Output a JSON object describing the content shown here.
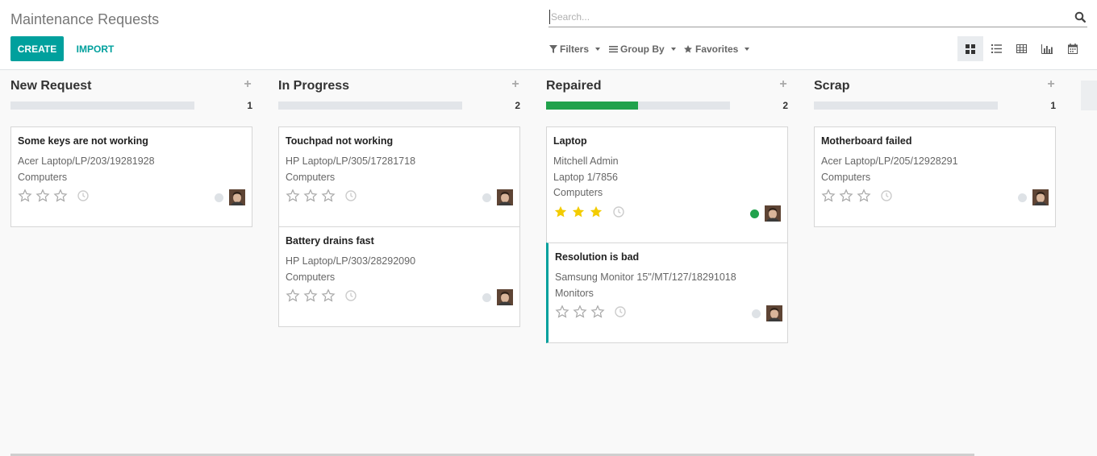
{
  "header": {
    "title": "Maintenance Requests",
    "create_label": "CREATE",
    "import_label": "IMPORT"
  },
  "search": {
    "placeholder": "Search...",
    "icon": "search-icon"
  },
  "filters": {
    "filters_label": "Filters",
    "groupby_label": "Group By",
    "favorites_label": "Favorites"
  },
  "views": [
    "kanban-view",
    "list-view",
    "pivot-view",
    "graph-view",
    "calendar-view"
  ],
  "colors": {
    "primary": "#00a09d",
    "success": "#21a24c",
    "star_filled": "#f3cc00",
    "star_empty": "#a8a8a8"
  },
  "columns": [
    {
      "title": "New Request",
      "count": "1",
      "progress_done": 0,
      "cards": [
        {
          "title": "Some keys are not working",
          "lines": [
            "Acer Laptop/LP/203/19281928",
            "Computers"
          ],
          "priority": 0,
          "state": "normal"
        }
      ]
    },
    {
      "title": "In Progress",
      "count": "2",
      "progress_done": 0,
      "cards": [
        {
          "title": "Touchpad not working",
          "lines": [
            "HP Laptop/LP/305/17281718",
            "Computers"
          ],
          "priority": 0,
          "state": "normal"
        },
        {
          "title": "Battery drains fast",
          "lines": [
            "HP Laptop/LP/303/28292090",
            "Computers"
          ],
          "priority": 0,
          "state": "normal"
        }
      ]
    },
    {
      "title": "Repaired",
      "count": "2",
      "progress_done": 0.5,
      "cards": [
        {
          "title": "Laptop",
          "lines": [
            "Mitchell Admin",
            "Laptop 1/7856",
            "Computers"
          ],
          "priority": 3,
          "state": "done"
        },
        {
          "title": "Resolution is bad",
          "lines": [
            "Samsung Monitor 15\"/MT/127/18291018",
            "Monitors"
          ],
          "priority": 0,
          "state": "normal"
        }
      ]
    },
    {
      "title": "Scrap",
      "count": "1",
      "progress_done": 0,
      "cards": [
        {
          "title": "Motherboard failed",
          "lines": [
            "Acer Laptop/LP/205/12928291",
            "Computers"
          ],
          "priority": 0,
          "state": "normal"
        }
      ]
    }
  ]
}
